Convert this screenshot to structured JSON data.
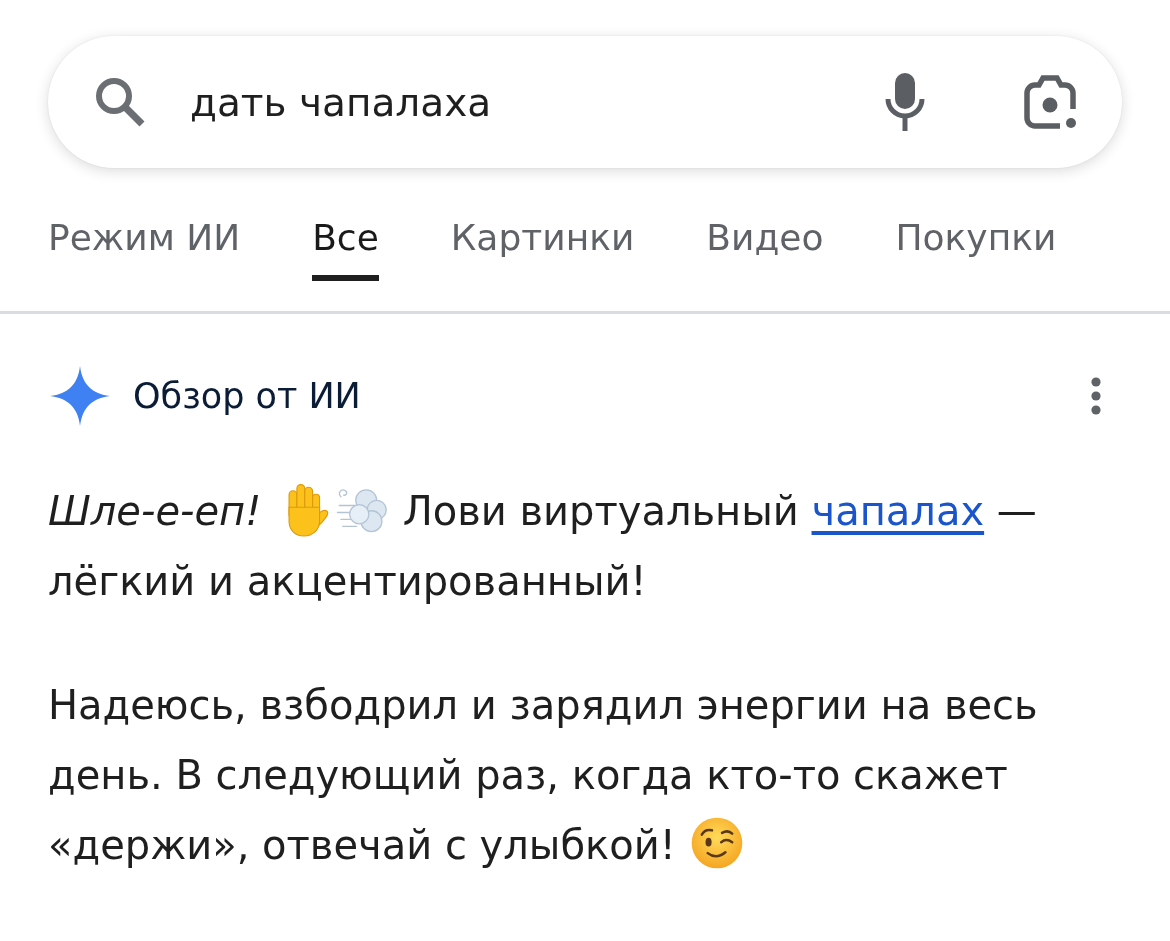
{
  "search": {
    "query": "дать чапалаха"
  },
  "tabs": [
    {
      "label": "Режим ИИ",
      "selected": false
    },
    {
      "label": "Все",
      "selected": true
    },
    {
      "label": "Картинки",
      "selected": false
    },
    {
      "label": "Видео",
      "selected": false
    },
    {
      "label": "Покупки",
      "selected": false
    }
  ],
  "ai_overview": {
    "title": "Обзор от ИИ",
    "paragraphs": [
      {
        "segments": [
          {
            "kind": "text",
            "text": "*Шле-е-еп!* "
          },
          {
            "kind": "emoji"
          },
          {
            "kind": "emoji"
          },
          {
            "kind": "text",
            "text": " Лови виртуальный "
          },
          {
            "kind": "link",
            "text": "чапалах"
          },
          {
            "kind": "text",
            "text": " — лёгкий и акцентированный!"
          }
        ]
      },
      {
        "segments": [
          {
            "kind": "text",
            "text": "Надеюсь, взбодрил и зарядил энергии на весь день. В следующий раз, когда кто-то скажет «держи», отвечай с улыбкой! "
          },
          {
            "kind": "emoji"
          }
        ]
      }
    ]
  }
}
